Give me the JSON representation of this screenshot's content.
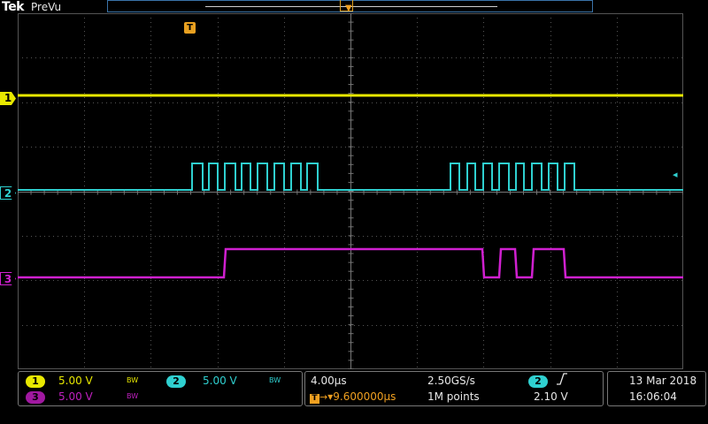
{
  "header": {
    "brand": "Tek",
    "mode": "PreVu"
  },
  "markers": {
    "trigger_position_icon": "trigger-position-T",
    "trigger_time_icon": "T",
    "ch1": "1",
    "ch2": "2",
    "ch3": "3",
    "trigger_level_icon": "◂"
  },
  "channels": [
    {
      "id": "1",
      "scale": "5.00 V",
      "bw": "BW",
      "color": "#e8e800"
    },
    {
      "id": "2",
      "scale": "5.00 V",
      "bw": "BW",
      "color": "#2fd0d0"
    },
    {
      "id": "3",
      "scale": "5.00 V",
      "bw": "BW",
      "color": "#c020c0"
    }
  ],
  "horizontal": {
    "timebase": "4.00µs",
    "sample_rate": "2.50GS/s",
    "delay": "▾9.600000µs",
    "record_length": "1M points"
  },
  "trigger": {
    "source": "2",
    "slope_icon": "rising-edge",
    "level": "2.10 V"
  },
  "datetime": {
    "date": "13 Mar  2018",
    "time": "16:06:04"
  },
  "colors": {
    "ch1": "#e8e800",
    "ch2": "#2fd0d0",
    "ch3": "#d020d0",
    "trigger": "#f0a020",
    "grid": "#555555"
  }
}
